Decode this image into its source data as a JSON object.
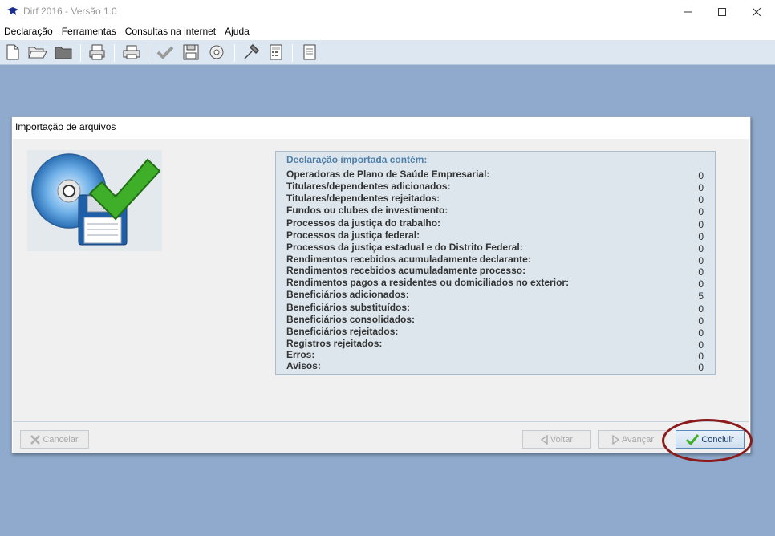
{
  "window": {
    "title": "Dirf 2016 - Versão 1.0"
  },
  "menu": {
    "items": [
      "Declaração",
      "Ferramentas",
      "Consultas na internet",
      "Ajuda"
    ]
  },
  "toolbar": {
    "icons": [
      "new-document-icon",
      "open-folder-icon",
      "folder-icon",
      "print-preview-icon",
      "print-icon",
      "check-icon",
      "save-icon",
      "save-as-icon",
      "settings-icon",
      "calculator-icon",
      "report-icon"
    ]
  },
  "dialog": {
    "title": "Importação de arquivos",
    "summary": {
      "heading": "Declaração importada contém:",
      "rows": [
        {
          "label": "Operadoras de Plano de Saúde Empresarial:",
          "value": "0"
        },
        {
          "label": "Titulares/dependentes adicionados:",
          "value": "0"
        },
        {
          "label": "Titulares/dependentes rejeitados:",
          "value": "0"
        },
        {
          "label": "Fundos ou clubes de investimento:",
          "value": "0"
        },
        {
          "label": "Processos da justiça do trabalho:",
          "value": "0"
        },
        {
          "label": "Processos da justiça federal:",
          "value": "0"
        },
        {
          "label": "Processos da justiça estadual e do Distrito Federal:",
          "value": "0"
        },
        {
          "label": "Rendimentos recebidos acumuladamente declarante:",
          "value": "0"
        },
        {
          "label": "Rendimentos recebidos acumuladamente processo:",
          "value": "0"
        },
        {
          "label": "Rendimentos pagos a residentes ou domiciliados no exterior:",
          "value": "0"
        },
        {
          "label": "Beneficiários adicionados:",
          "value": "5"
        },
        {
          "label": "Beneficiários substituídos:",
          "value": "0"
        },
        {
          "label": "Beneficiários consolidados:",
          "value": "0"
        },
        {
          "label": "Beneficiários rejeitados:",
          "value": "0"
        },
        {
          "label": "Registros rejeitados:",
          "value": "0"
        },
        {
          "label": "Erros:",
          "value": "0"
        },
        {
          "label": "Avisos:",
          "value": "0"
        }
      ]
    },
    "buttons": {
      "cancel": "Cancelar",
      "back": "Voltar",
      "next": "Avançar",
      "finish": "Concluir"
    }
  },
  "colors": {
    "workspace": "#8faacc",
    "heading_blue": "#4f7fa8",
    "highlight_ring": "#8b1b1b",
    "check_green": "#3fae29"
  }
}
